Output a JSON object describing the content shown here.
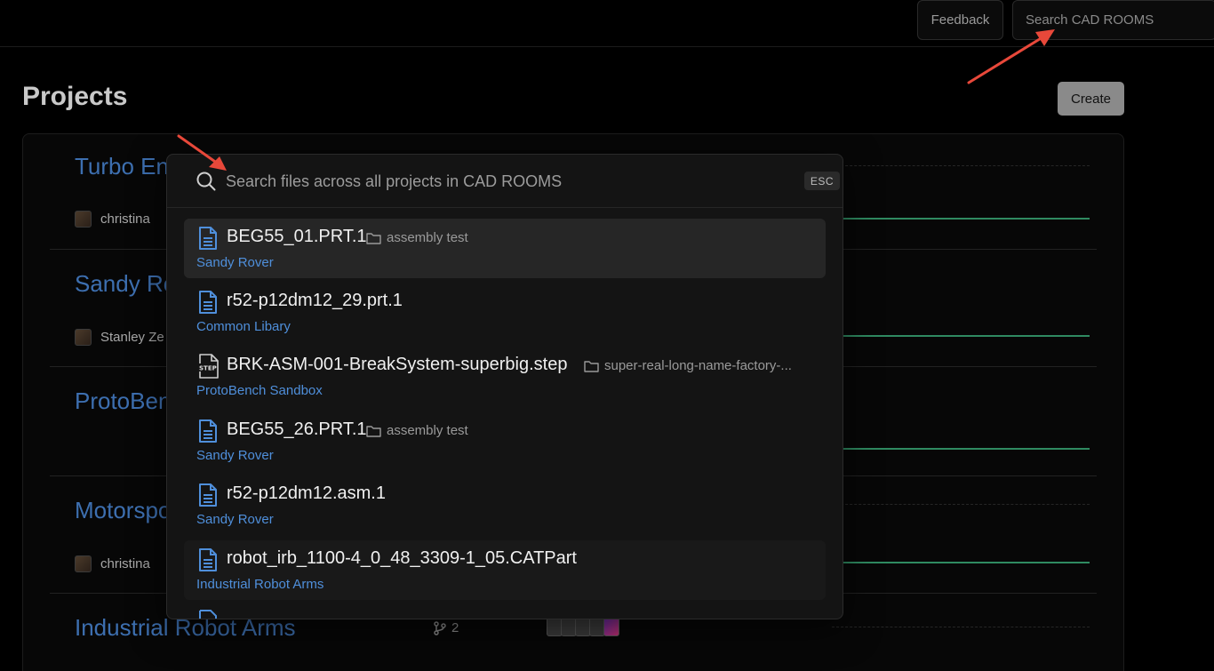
{
  "topbar": {
    "feedback_label": "Feedback",
    "search_placeholder": "Search CAD ROOMS"
  },
  "page": {
    "title": "Projects",
    "create_label": "Create"
  },
  "projects": [
    {
      "name": "Turbo En",
      "owner": "christina"
    },
    {
      "name": "Sandy Ro",
      "owner": "Stanley Ze"
    },
    {
      "name": "ProtoBen",
      "owner": ""
    },
    {
      "name": "Motorspo",
      "owner": "christina"
    },
    {
      "name": "Industrial Robot Arms",
      "owner": "",
      "branches": "2"
    }
  ],
  "modal": {
    "search_placeholder": "Search files across all projects in CAD ROOMS",
    "esc_label": "ESC",
    "results": [
      {
        "name": "BEG55_01.PRT.1",
        "folder": "assembly test",
        "project": "Sandy Rover",
        "icon": "file-icon"
      },
      {
        "name": "r52-p12dm12_29.prt.1",
        "folder": "",
        "project": "Common Libary",
        "icon": "file-icon"
      },
      {
        "name": "BRK-ASM-001-BreakSystem-superbig.step",
        "folder": "super-real-long-name-factory-...",
        "project": "ProtoBench Sandbox",
        "icon": "step-file-icon"
      },
      {
        "name": "BEG55_26.PRT.1",
        "folder": "assembly test",
        "project": "Sandy Rover",
        "icon": "file-icon"
      },
      {
        "name": "r52-p12dm12.asm.1",
        "folder": "",
        "project": "Sandy Rover",
        "icon": "file-icon"
      },
      {
        "name": "robot_irb_1100-4_0_48_3309-1_05.CATPart",
        "folder": "",
        "project": "Industrial Robot Arms",
        "icon": "file-icon"
      }
    ]
  },
  "colors": {
    "link_blue": "#4f8fdb",
    "accent_green": "#2f8a61",
    "arrow_red": "#e8483a"
  }
}
